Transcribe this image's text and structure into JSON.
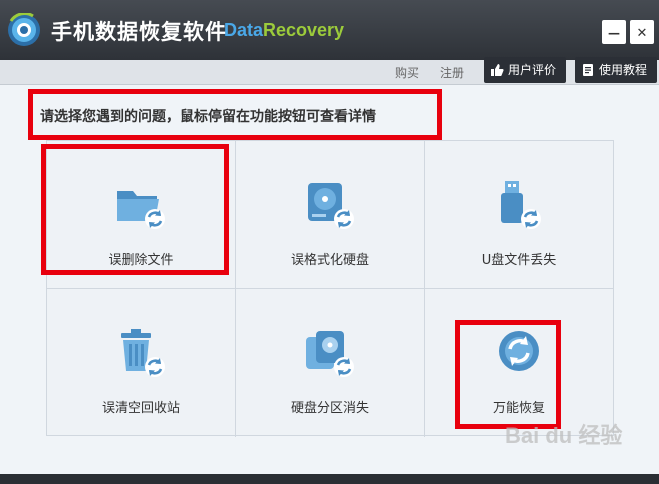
{
  "window": {
    "title": "手机数据恢复软件",
    "brand_part1": "Data",
    "brand_part2": "Recovery",
    "minimize_glyph": "—",
    "close_glyph": "✕"
  },
  "toolbar": {
    "buy": "购买",
    "register": "注册",
    "review": "用户评价",
    "tutorial": "使用教程"
  },
  "main": {
    "prompt": "请选择您遇到的问题，鼠标停留在功能按钮可查看详情",
    "options": [
      {
        "label": "误删除文件",
        "icon": "folder-refresh-icon"
      },
      {
        "label": "误格式化硬盘",
        "icon": "harddisk-refresh-icon"
      },
      {
        "label": "U盘文件丢失",
        "icon": "usb-refresh-icon"
      },
      {
        "label": "误清空回收站",
        "icon": "recyclebin-refresh-icon"
      },
      {
        "label": "硬盘分区消失",
        "icon": "partition-refresh-icon"
      },
      {
        "label": "万能恢复",
        "icon": "universal-refresh-icon"
      }
    ]
  },
  "watermark": "Bai du 经验",
  "colors": {
    "titlebar": "#383d44",
    "accent_blue": "#4a8ec4",
    "highlight_red": "#e8000e"
  }
}
